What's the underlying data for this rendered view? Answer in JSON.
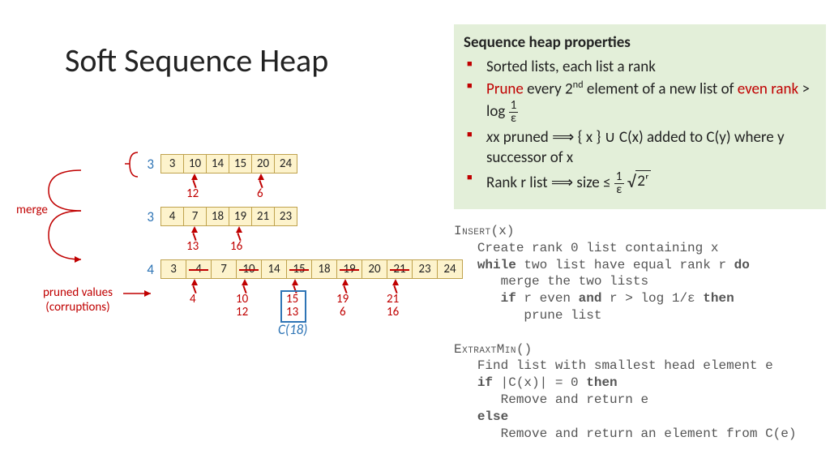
{
  "title": "Soft Sequence Heap",
  "panel": {
    "heading": "Sequence heap properties",
    "item1": "Sorted lists, each list a rank",
    "item2a": "Prune",
    "item2b": " every 2",
    "item2c": " element of a new list of ",
    "item2d": "even rank",
    "item2e": " > log ",
    "frac1_num": "1",
    "frac1_den": "ε",
    "item3a": "x pruned ",
    "item3b": " { x } ∪ C(x) added to C(y) where y successor of x",
    "item4a": "Rank r list ",
    "item4b": " size ≤ ",
    "sqrt_arg": "2ʳ",
    "nd": "nd",
    "arrow": "⟹"
  },
  "code": {
    "insert_name": "Insert",
    "insert_args": "(x)",
    "l1": "Create rank 0 list containing x",
    "l2a": "while",
    "l2b": " two list have equal rank r ",
    "l2c": "do",
    "l3": "merge the two lists",
    "l4a": "if",
    "l4b": " r even ",
    "l4c": "and",
    "l4d": " r > log 1/ε ",
    "l4e": "then",
    "l5": "prune list",
    "extract_name": "ExtraxtMin",
    "extract_args": "()",
    "e1": "Find list with smallest head element e",
    "e2a": "if",
    "e2b": " |C(x)| = 0 ",
    "e2c": "then",
    "e3": "Remove and return e",
    "e4": "else",
    "e5": "Remove and return an element from C(e)"
  },
  "diagram": {
    "merge_label": "merge",
    "pruned_label1": "pruned values",
    "pruned_label2": "(corruptions)",
    "c18": "C(18)",
    "row1": {
      "rank": "3",
      "cells": [
        "3",
        "10",
        "14",
        "15",
        "20",
        "24"
      ],
      "below": [
        "12",
        "6"
      ]
    },
    "row2": {
      "rank": "3",
      "cells": [
        "4",
        "7",
        "18",
        "19",
        "21",
        "23"
      ],
      "below": [
        "13",
        "16"
      ]
    },
    "row3": {
      "rank": "4",
      "cells": [
        "3",
        "4",
        "7",
        "10",
        "14",
        "15",
        "18",
        "19",
        "20",
        "21",
        "23",
        "24"
      ],
      "struck": [
        1,
        3,
        5,
        7,
        9
      ],
      "below_line1": [
        "4",
        "10",
        "15",
        "19",
        "21"
      ],
      "below_line2": [
        "",
        "12",
        "13",
        "6",
        "16"
      ]
    }
  }
}
